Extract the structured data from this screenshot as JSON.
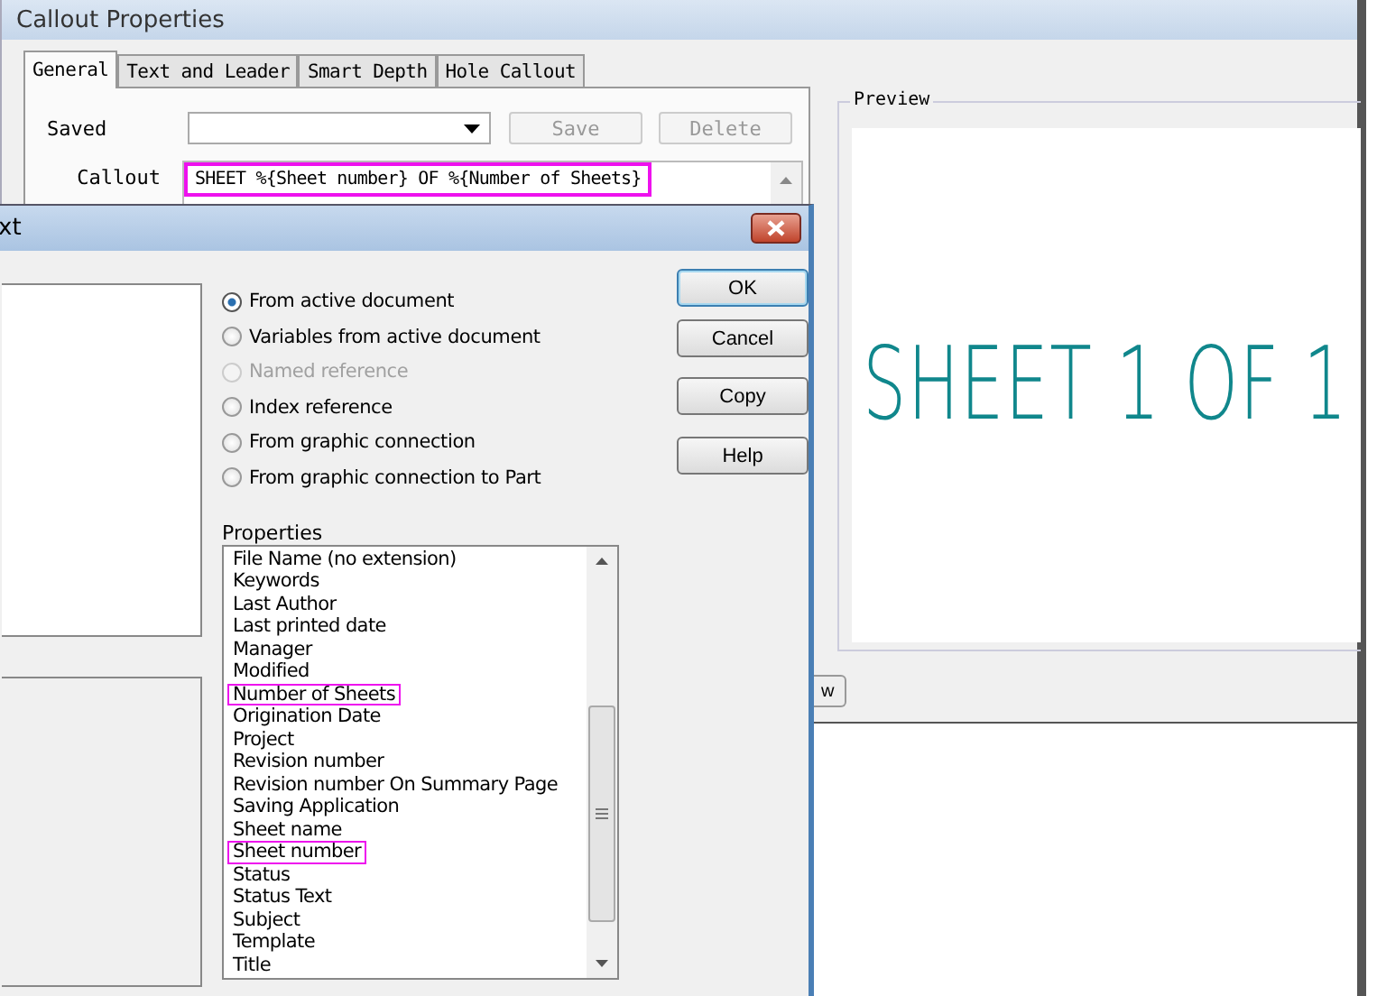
{
  "callout_properties": {
    "title": "Callout Properties",
    "tabs": [
      {
        "label": "General",
        "selected": true
      },
      {
        "label": "Text and Leader",
        "selected": false
      },
      {
        "label": "Smart Depth",
        "selected": false
      },
      {
        "label": "Hole Callout",
        "selected": false
      }
    ],
    "saved_label": "Saved",
    "save_button": {
      "label": "Save",
      "disabled": true
    },
    "delete_button": {
      "label": "Delete",
      "disabled": true
    },
    "callout_label": "Callout",
    "callout": {
      "value": "SHEET %{Sheet number} OF %{Number of Sheets}",
      "highlighted": true
    },
    "preview_label": "Preview",
    "preview_text": "SHEET 1 OF 1",
    "partial_button": "w"
  },
  "dialog": {
    "title": "xt",
    "options": [
      {
        "label": "From active document",
        "selected": true,
        "disabled": false
      },
      {
        "label": "Variables from active document",
        "selected": false,
        "disabled": false
      },
      {
        "label": "Named reference",
        "selected": false,
        "disabled": true
      },
      {
        "label": "Index reference",
        "selected": false,
        "disabled": false
      },
      {
        "label": "From graphic connection",
        "selected": false,
        "disabled": false
      },
      {
        "label": "From graphic connection to Part",
        "selected": false,
        "disabled": false
      }
    ],
    "buttons": [
      {
        "label": "OK",
        "default": true
      },
      {
        "label": "Cancel",
        "default": false
      },
      {
        "label": "Copy",
        "default": false
      },
      {
        "label": "Help",
        "default": false
      }
    ],
    "properties_label": "Properties",
    "properties": [
      {
        "label": "File Name (no extension)",
        "highlighted": false
      },
      {
        "label": "Keywords",
        "highlighted": false
      },
      {
        "label": "Last Author",
        "highlighted": false
      },
      {
        "label": "Last printed date",
        "highlighted": false
      },
      {
        "label": "Manager",
        "highlighted": false
      },
      {
        "label": "Modified",
        "highlighted": false
      },
      {
        "label": "Number of Sheets",
        "highlighted": true
      },
      {
        "label": "Origination Date",
        "highlighted": false
      },
      {
        "label": "Project",
        "highlighted": false
      },
      {
        "label": "Revision number",
        "highlighted": false
      },
      {
        "label": "Revision number On Summary Page",
        "highlighted": false
      },
      {
        "label": "Saving Application",
        "highlighted": false
      },
      {
        "label": "Sheet name",
        "highlighted": false
      },
      {
        "label": "Sheet number",
        "highlighted": true
      },
      {
        "label": "Status",
        "highlighted": false
      },
      {
        "label": "Status Text",
        "highlighted": false
      },
      {
        "label": "Subject",
        "highlighted": false
      },
      {
        "label": "Template",
        "highlighted": false
      },
      {
        "label": "Title",
        "highlighted": false
      }
    ]
  }
}
